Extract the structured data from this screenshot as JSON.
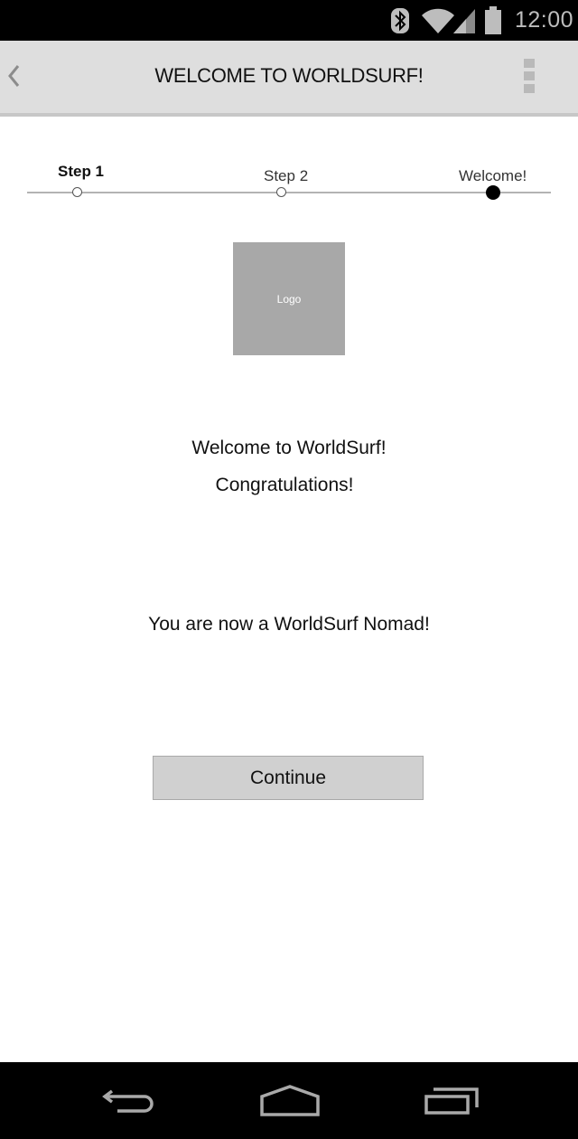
{
  "status_bar": {
    "time": "12:00",
    "icons": [
      "bluetooth-icon",
      "wifi-icon",
      "signal-icon",
      "battery-icon"
    ]
  },
  "app_bar": {
    "title": "WELCOME TO WORLDSURF!",
    "back_icon": "chevron-left-icon",
    "menu_icon": "overflow-menu-icon"
  },
  "stepper": {
    "steps": [
      {
        "label": "Step 1",
        "state": "completed"
      },
      {
        "label": "Step 2",
        "state": "completed"
      },
      {
        "label": "Welcome!",
        "state": "current"
      }
    ]
  },
  "logo": {
    "label": "Logo"
  },
  "content": {
    "welcome": "Welcome to WorldSurf!",
    "congrats": "Congratulations!",
    "nomad": "You are now a WorldSurf Nomad!"
  },
  "actions": {
    "continue_label": "Continue"
  },
  "nav_bar": {
    "icons": [
      "back-icon",
      "home-icon",
      "recent-apps-icon"
    ]
  },
  "colors": {
    "status_bar_bg": "#000000",
    "app_bar_bg": "#dedede",
    "logo_bg": "#a8a8a8",
    "button_bg": "#d0d0d0"
  }
}
